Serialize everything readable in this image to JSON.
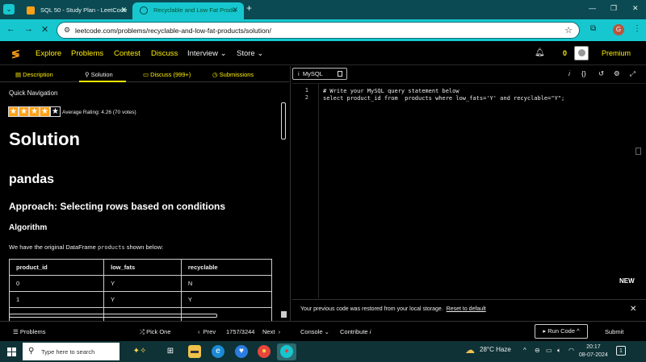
{
  "browser": {
    "tabs": [
      {
        "title": "SQL 50 - Study Plan - LeetCode"
      },
      {
        "title": "Recyclable and Low Fat Produ"
      }
    ],
    "new_tab": "+",
    "url": "leetcode.com/problems/recyclable-and-low-fat-products/solution/",
    "profile_initial": "G"
  },
  "header": {
    "nav": [
      "Explore",
      "Problems",
      "Contest",
      "Discuss",
      "Interview",
      "Store"
    ],
    "coins": "0",
    "premium": "Premium"
  },
  "left_tabs": [
    "Description",
    "Solution",
    "Discuss (999+)",
    "Submissions"
  ],
  "solution": {
    "quick_nav": "Quick Navigation",
    "rating_text": "Average Rating: 4.26 (70 votes)",
    "rating_stars": 4,
    "title": "Solution",
    "section": "pandas",
    "approach": "Approach: Selecting rows based on conditions",
    "algorithm": "Algorithm",
    "para_before": "We have the original DataFrame",
    "para_code": "products",
    "para_after": "shown below:",
    "table": {
      "headers": [
        "product_id",
        "low_fats",
        "recyclable"
      ],
      "rows": [
        [
          "0",
          "Y",
          "N"
        ],
        [
          "1",
          "Y",
          "Y"
        ]
      ]
    }
  },
  "editor": {
    "language": "MySQL",
    "line_numbers": [
      "1",
      "2"
    ],
    "lines": [
      "# Write your MySQL query statement below",
      "select product_id from  products where low_fats='Y' and recyclable=\"Y\";"
    ],
    "new_label": "NEW",
    "notice": "Your previous code was restored from your local storage.",
    "notice_link": "Reset to default"
  },
  "bottom": {
    "problems": "Problems",
    "pick_one": "Pick One",
    "prev": "Prev",
    "counter": "1757/3244",
    "next": "Next",
    "console": "Console",
    "contribute": "Contribute",
    "run_code": "Run Code",
    "submit": "Submit"
  },
  "taskbar": {
    "search_placeholder": "Type here to search",
    "weather": "28°C  Haze",
    "time": "20:17",
    "date": "08-07-2024"
  },
  "colors": {
    "accent": "#ffef00",
    "browser": "#17c7cf",
    "logo": "#ffa116"
  }
}
